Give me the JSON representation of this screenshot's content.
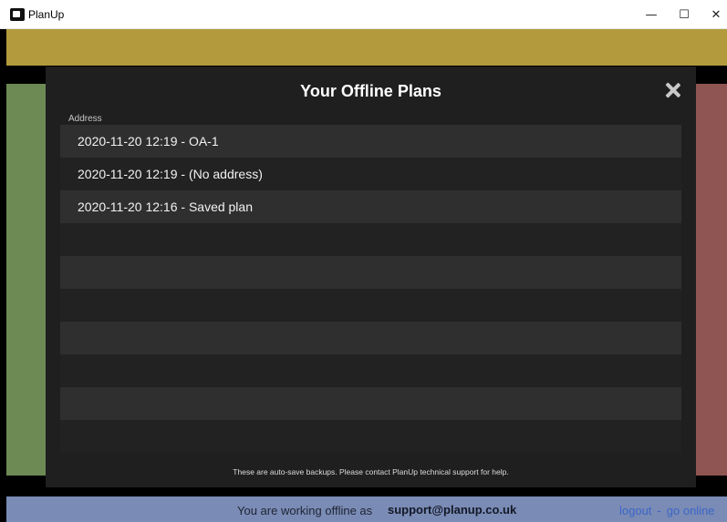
{
  "window": {
    "title": "PlanUp",
    "controls": {
      "minimize": "—",
      "maximize": "☐",
      "close": "✕"
    }
  },
  "modal": {
    "title": "Your Offline Plans",
    "close_icon": "close-icon",
    "column_header": "Address",
    "plans": [
      "2020-11-20 12:19 - OA-1",
      "2020-11-20 12:19 - (No address)",
      "2020-11-20 12:16 - Saved plan",
      "",
      "",
      "",
      "",
      "",
      "",
      "",
      ""
    ],
    "footer": "These are auto-save backups. Please contact PlanUp technical support for help."
  },
  "statusbar": {
    "text": "You are working offline as",
    "email": "support@planup.co.uk",
    "logout": "logout",
    "separator": "-",
    "go_online": "go online"
  },
  "colors": {
    "top_band": "#b39a3d",
    "left_band": "#6d8a55",
    "right_band": "#8f5553",
    "statusbar": "#7a8bb5",
    "modal_bg": "#1f1f1f"
  }
}
